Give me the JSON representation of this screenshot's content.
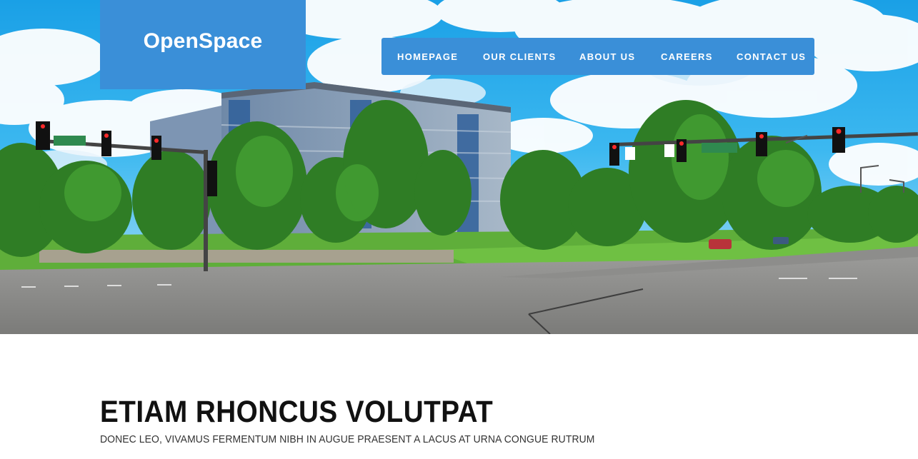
{
  "brand": {
    "name": "OpenSpace",
    "accent_color": "#3a8fd8"
  },
  "nav": {
    "items": [
      {
        "label": "HOMEPAGE"
      },
      {
        "label": "OUR CLIENTS"
      },
      {
        "label": "ABOUT US"
      },
      {
        "label": "CAREERS"
      },
      {
        "label": "CONTACT US"
      }
    ]
  },
  "hero": {
    "image_alt": "office-building-intersection-photo"
  },
  "content": {
    "title": "ETIAM RHONCUS VOLUTPAT",
    "subtitle": "DONEC LEO, VIVAMUS FERMENTUM NIBH IN AUGUE PRAESENT A LACUS AT URNA CONGUE RUTRUM"
  }
}
